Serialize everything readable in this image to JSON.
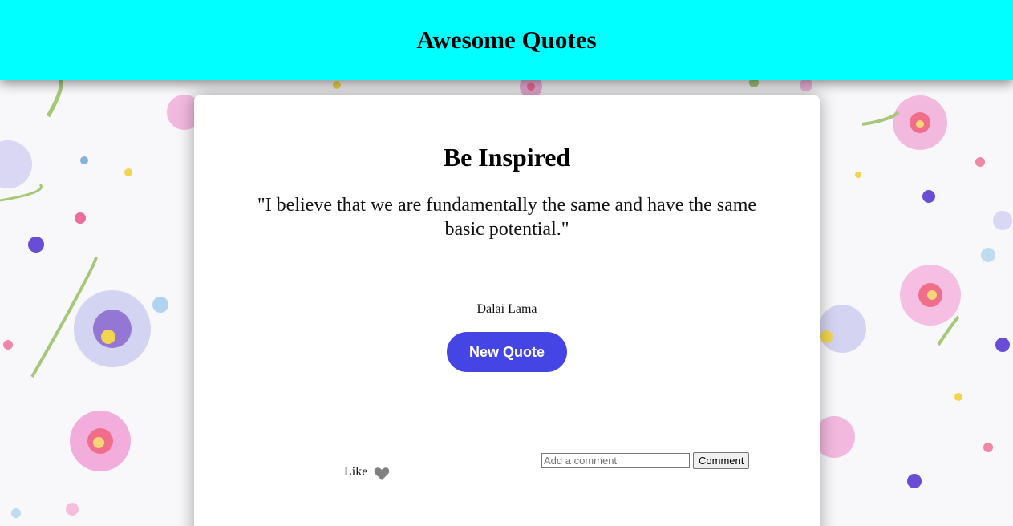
{
  "header": {
    "title": "Awesome Quotes"
  },
  "card": {
    "title": "Be Inspired",
    "quote": "\"I believe that we are fundamentally the same and have the same basic potential.\"",
    "author": "Dalai Lama",
    "new_quote_label": "New Quote",
    "like_label": "Like",
    "comment_placeholder": "Add a comment",
    "comment_button_label": "Comment"
  },
  "icons": {
    "like": "heart-icon"
  },
  "colors": {
    "header_bg": "#00ffff",
    "button_bg": "#4545e6",
    "button_text": "#ffffff",
    "heart": "#808080"
  }
}
